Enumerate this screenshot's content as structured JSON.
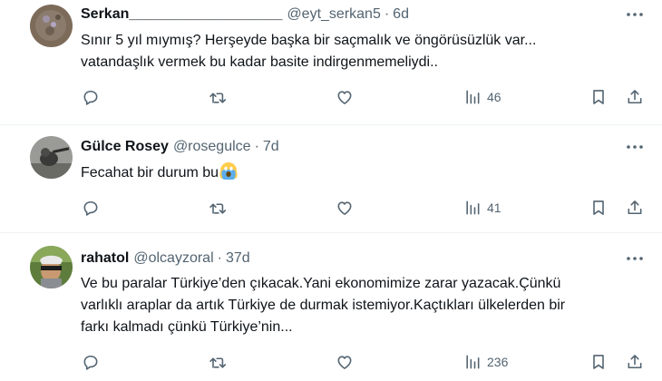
{
  "tweets": [
    {
      "name": "Serkan___________________",
      "handle": "@eyt_serkan5",
      "time": "6d",
      "text_line1": "Sınır 5 yıl mıymış? Herşeyde başka bir saçmalık ve öngörüsüzlük var...",
      "text_line2": "vatandaşlık vermek bu kadar basite indirgenmemeliydi..",
      "views": "46"
    },
    {
      "name": "Gülce Rosey",
      "handle": "@rosegulce",
      "time": "7d",
      "text_line1": "Fecahat bir durum bu",
      "views": "41"
    },
    {
      "name": "rahatol",
      "handle": "@olcayzoral",
      "time": "37d",
      "text_line1": "Ve bu paralar Türkiye’den çıkacak.Yani ekonomimize zarar yazacak.Çünkü",
      "text_line2": "varlıklı araplar da artık Türkiye de durmak istemiyor.Kaçtıkları ülkelerden bir",
      "text_line3": "farkı kalmadı çünkü Türkiye’nin...",
      "views": "236"
    }
  ],
  "separator": "·",
  "icons": {
    "reply": "reply-icon",
    "retweet": "retweet-icon",
    "like": "heart-icon",
    "views": "views-chart-icon",
    "bookmark": "bookmark-icon",
    "share": "share-icon",
    "more": "more-dots-icon",
    "emoji": "screaming-face-emoji"
  },
  "colors": {
    "text": "#0f1419",
    "secondary": "#536471",
    "divider": "#eff3f4"
  }
}
